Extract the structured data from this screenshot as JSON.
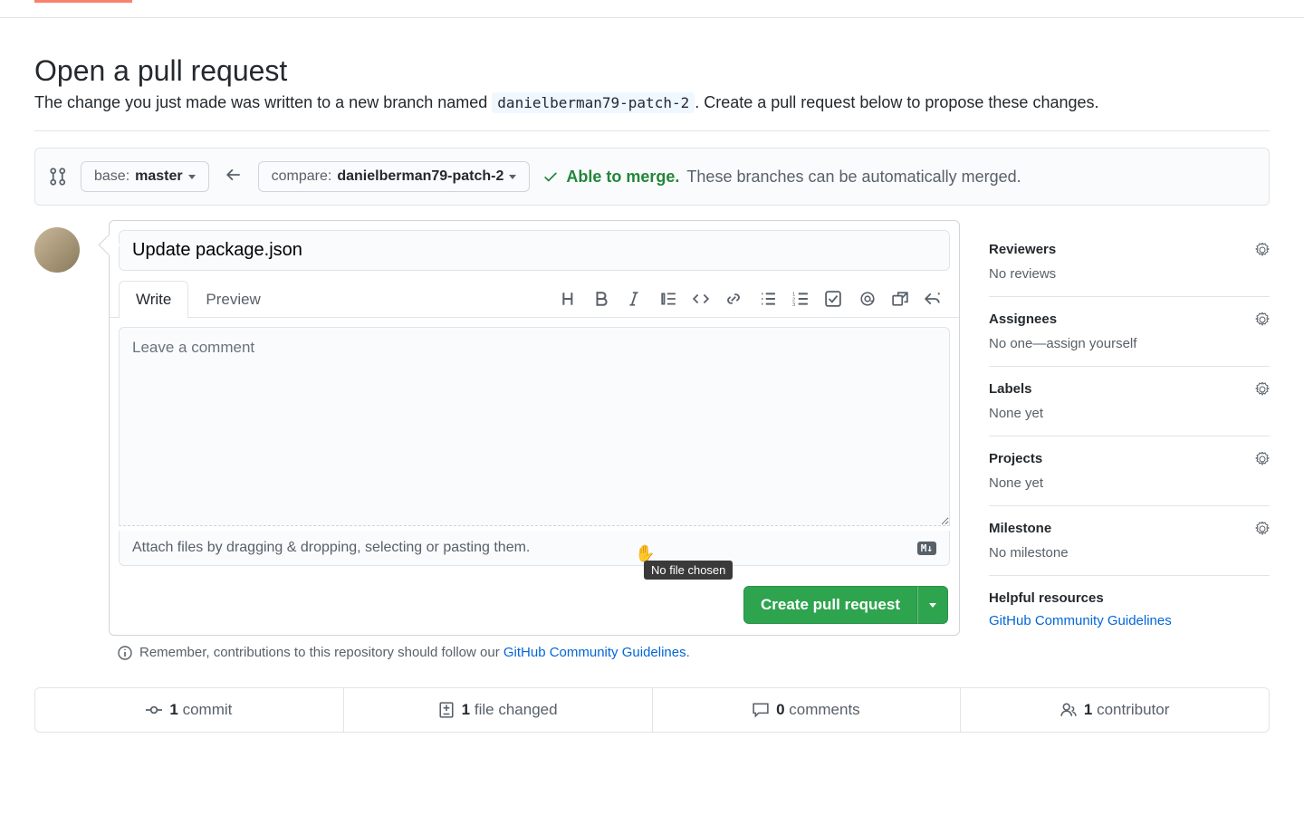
{
  "header": {
    "title": "Open a pull request",
    "subhead_prefix": "The change you just made was written to a new branch named ",
    "branch_name": "danielberman79-patch-2",
    "subhead_suffix": ". Create a pull request below to propose these changes."
  },
  "compare": {
    "base_label": "base: ",
    "base_value": "master",
    "compare_label": "compare: ",
    "compare_value": "danielberman79-patch-2",
    "merge_able": "Able to merge.",
    "merge_desc": "These branches can be automatically merged."
  },
  "form": {
    "title_value": "Update package.json",
    "tab_write": "Write",
    "tab_preview": "Preview",
    "comment_placeholder": "Leave a comment",
    "attach_hint": "Attach files by dragging & dropping, selecting or pasting them.",
    "md_badge": "M↓",
    "create_btn": "Create pull request",
    "tooltip": "No file chosen",
    "reminder_prefix": "Remember, contributions to this repository should follow our ",
    "reminder_link": "GitHub Community Guidelines",
    "reminder_suffix": "."
  },
  "sidebar": {
    "reviewers": {
      "title": "Reviewers",
      "text": "No reviews"
    },
    "assignees": {
      "title": "Assignees",
      "text_prefix": "No one—",
      "assign_self": "assign yourself"
    },
    "labels": {
      "title": "Labels",
      "text": "None yet"
    },
    "projects": {
      "title": "Projects",
      "text": "None yet"
    },
    "milestone": {
      "title": "Milestone",
      "text": "No milestone"
    },
    "helpful": {
      "title": "Helpful resources",
      "link": "GitHub Community Guidelines"
    }
  },
  "stats": {
    "commits_n": "1",
    "commits_t": "commit",
    "files_n": "1",
    "files_t": "file changed",
    "comments_n": "0",
    "comments_t": "comments",
    "contrib_n": "1",
    "contrib_t": "contributor"
  },
  "colors": {
    "accent_orange": "#f9826c",
    "primary_green": "#2ea44f",
    "success_text": "#22863a",
    "link_blue": "#0366d6"
  }
}
